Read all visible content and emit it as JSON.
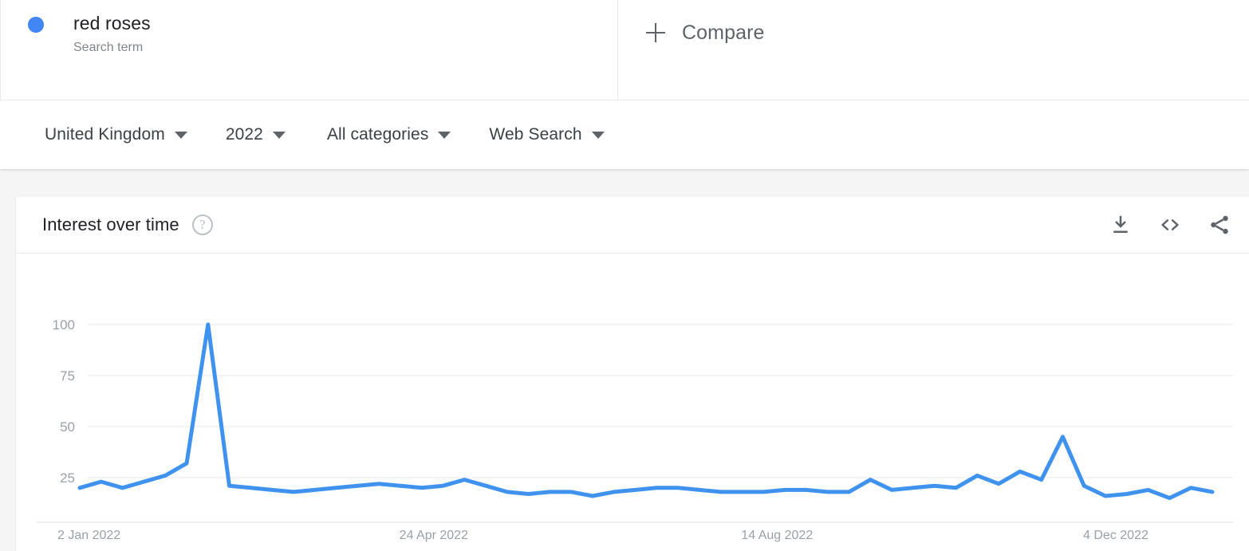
{
  "terms": [
    {
      "label": "red roses",
      "sublabel": "Search term",
      "color": "#4285f4",
      "dot_icon": "legend-dot-icon"
    }
  ],
  "compare": {
    "label": "Compare",
    "icon": "plus-icon"
  },
  "filters": [
    {
      "id": "region",
      "label": "United Kingdom",
      "caret_icon": "chevron-down-icon"
    },
    {
      "id": "time",
      "label": "2022",
      "caret_icon": "chevron-down-icon"
    },
    {
      "id": "category",
      "label": "All categories",
      "caret_icon": "chevron-down-icon"
    },
    {
      "id": "type",
      "label": "Web Search",
      "caret_icon": "chevron-down-icon"
    }
  ],
  "card": {
    "title": "Interest over time",
    "help_icon": "help-circle-icon",
    "help_glyph": "?",
    "actions": [
      {
        "id": "download",
        "icon": "download-icon"
      },
      {
        "id": "embed",
        "icon": "code-embed-icon"
      },
      {
        "id": "share",
        "icon": "share-icon"
      }
    ]
  },
  "chart_data": {
    "type": "line",
    "title": "Interest over time",
    "xlabel": "",
    "ylabel": "",
    "ylim": [
      0,
      100
    ],
    "yticks": [
      25,
      50,
      75,
      100
    ],
    "grid": true,
    "legend_position": "top",
    "line_color": "#3f93ef",
    "line_width": 5,
    "xtick_labels": [
      "2 Jan 2022",
      "24 Apr 2022",
      "14 Aug 2022",
      "4 Dec 2022"
    ],
    "xtick_indices": [
      0,
      16,
      32,
      48
    ],
    "series": [
      {
        "name": "red roses",
        "color": "#3f93ef",
        "values": [
          20,
          23,
          20,
          23,
          26,
          32,
          100,
          21,
          20,
          19,
          18,
          19,
          20,
          21,
          22,
          21,
          20,
          21,
          24,
          21,
          18,
          17,
          18,
          18,
          16,
          18,
          19,
          20,
          20,
          19,
          18,
          18,
          18,
          19,
          19,
          18,
          18,
          24,
          19,
          20,
          21,
          20,
          26,
          22,
          28,
          24,
          45,
          21,
          16,
          17,
          19,
          15,
          20,
          18
        ]
      }
    ]
  }
}
